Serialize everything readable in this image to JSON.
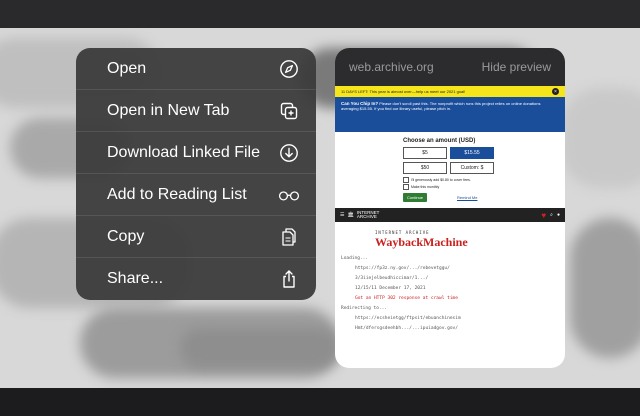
{
  "menu": {
    "items": [
      {
        "label": "Open",
        "icon": "compass-icon"
      },
      {
        "label": "Open in New Tab",
        "icon": "new-tab-icon"
      },
      {
        "label": "Download Linked File",
        "icon": "download-icon"
      },
      {
        "label": "Add to Reading List",
        "icon": "glasses-icon"
      },
      {
        "label": "Copy",
        "icon": "copy-icon"
      },
      {
        "label": "Share...",
        "icon": "share-icon"
      }
    ]
  },
  "preview": {
    "url": "web.archive.org",
    "hide_label": "Hide preview",
    "yellow_banner": "11 DAYS LEFT: This year is almost over—help us meet our 2021 goal!",
    "blue_banner_title": "Can You Chip In?",
    "blue_banner_text": "Please don't scroll past this. The nonprofit which runs this project relies on online donations averaging $15.55. If you find our library useful, please pitch in.",
    "donate_heading": "Choose an amount (USD)",
    "amounts": [
      "$5",
      "$15.55",
      "$50",
      "Custom: $"
    ],
    "selected_amount": "$15.55",
    "check1": "I'll generously add $0.80 to cover fees.",
    "check2": "Make this monthly",
    "continue_label": "Continue",
    "remind_label": "Remind Me",
    "ia_logo_line1": "INTERNET",
    "ia_logo_line2": "ARCHIVE",
    "wb_small": "INTERNET ARCHIVE",
    "wb_big": "WaybackMachine",
    "loading": "Loading...",
    "url_line1": "https://fp3z.ny.gov/.../rebevetggu/",
    "url_line2": "3/3iiejelbeudhiccimar/1.../",
    "url_line3": "12/15/11 December 17, 2021",
    "error_line": "Got an HTTP 302 response at crawl time",
    "redirect": "Redirecting to...",
    "redir_line1": "https://ecsheietgg/ftpsit/ebuanchinesim",
    "redir_line2": "Hmt/dfersgsdeehbh.../...ipuiadgov.gov/"
  },
  "colors": {
    "menu_bg": "#3a3a3c",
    "blue_banner": "#1a4d9a",
    "yellow_banner": "#f5e51a",
    "wayback_red": "#c9211e"
  }
}
